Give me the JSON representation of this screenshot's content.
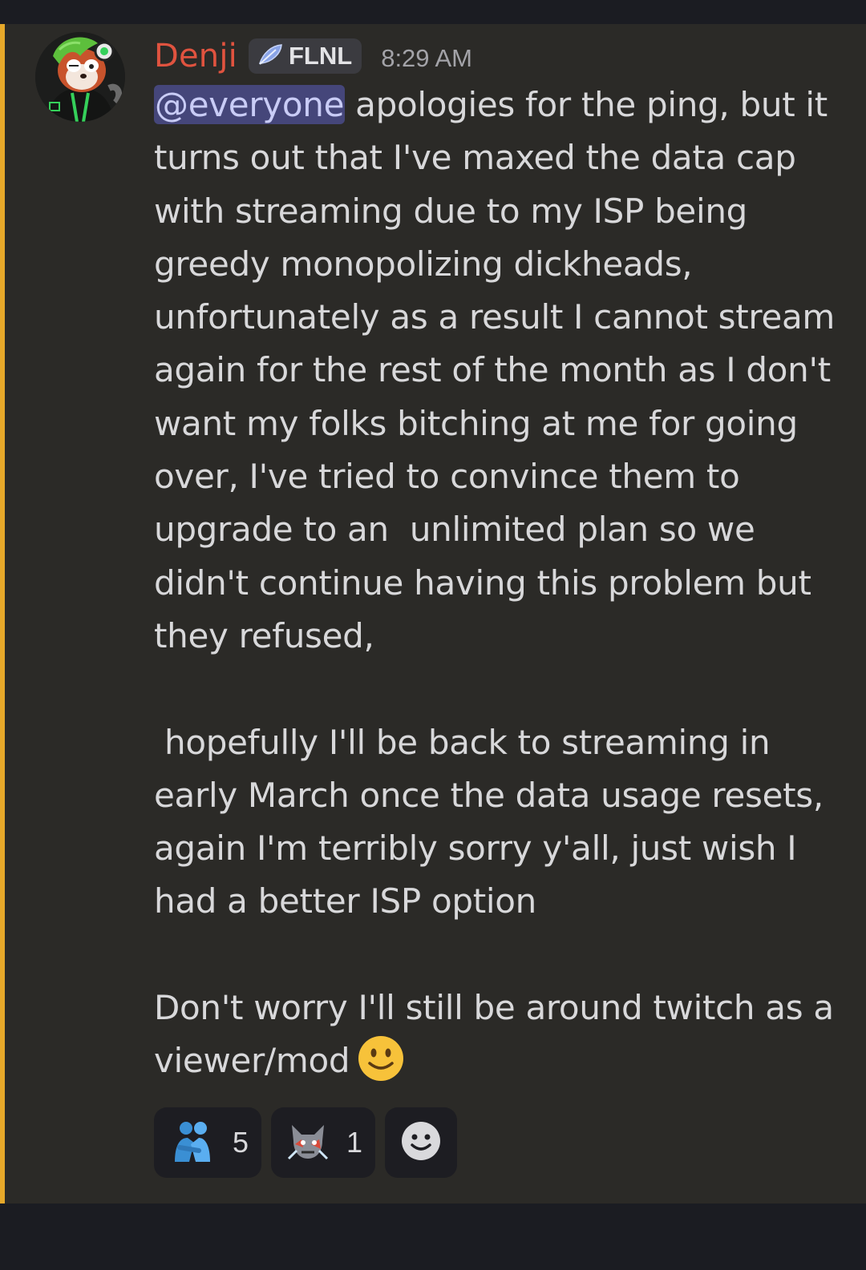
{
  "message": {
    "author": "Denji",
    "role_tag": "FLNL",
    "timestamp": "8:29 AM",
    "mention": "@everyone",
    "lines": [
      " apologies for the ping, but it",
      "turns out that I've maxed the data cap",
      "with streaming due to my ISP being",
      "greedy monopolizing dickheads,",
      "unfortunately as a result I cannot stream",
      "again for the rest of the month as I don't",
      "want my folks bitching at me for going",
      "over, I've tried to convince them to",
      "upgrade to an  unlimited plan so we",
      "didn't continue having this problem but",
      "they refused,",
      "",
      " hopefully I'll be back to streaming in",
      "early March once the data usage resets,",
      "again I'm terribly sorry y'all, just wish I",
      "had a better ISP option",
      "",
      "Don't worry I'll still be around twitch as a",
      "viewer/mod"
    ],
    "highlight_color": "#e6a82a",
    "author_color": "#e0533f"
  },
  "reactions": [
    {
      "emoji": "hugging-people-icon",
      "count": "5"
    },
    {
      "emoji": "custom-emote-icon",
      "count": "1"
    }
  ],
  "add_reaction": {
    "icon": "add-reaction-smiley-icon"
  }
}
